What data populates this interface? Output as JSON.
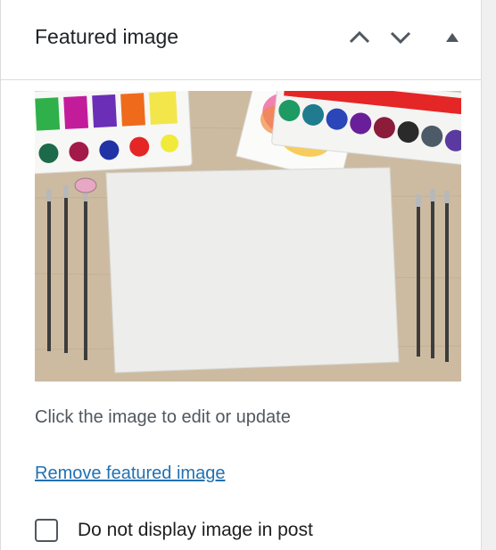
{
  "panel": {
    "title": "Featured image",
    "help_text": "Click the image to edit or update",
    "remove_link": "Remove featured image",
    "checkbox_label": "Do not display image in post",
    "checkbox_checked": false
  },
  "icons": {
    "move_up": "chevron-up-icon",
    "move_down": "chevron-down-icon",
    "toggle": "triangle-up-icon"
  },
  "colors": {
    "link": "#2271b1",
    "panel_bg": "#ffffff",
    "divider": "#dcdcde",
    "text_muted": "#50575e"
  }
}
